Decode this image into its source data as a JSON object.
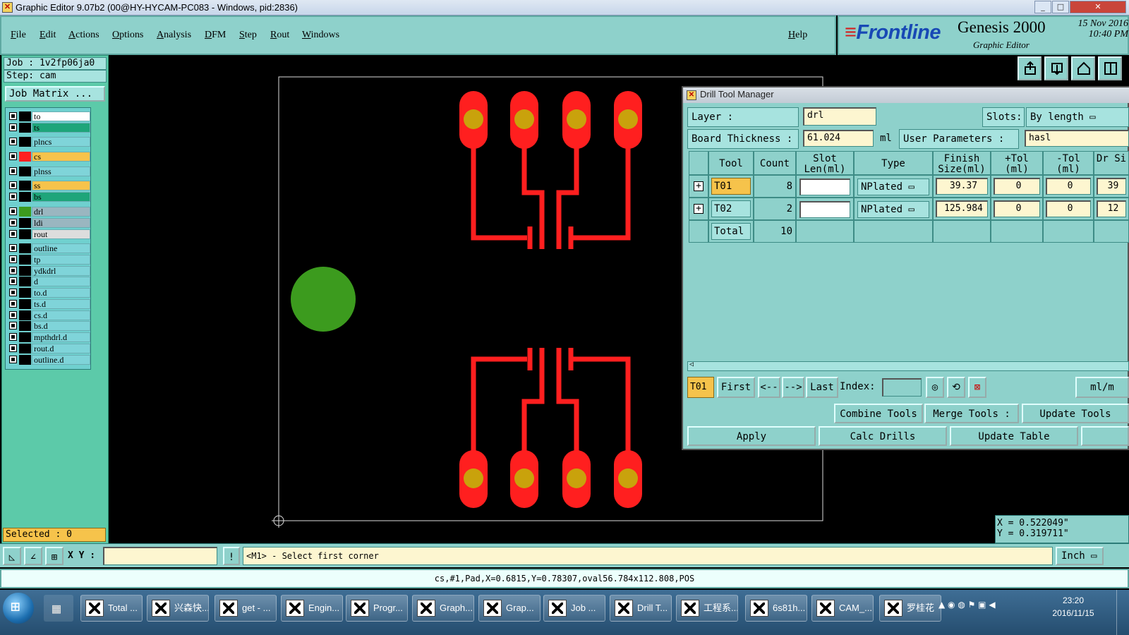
{
  "window": {
    "title": "Graphic Editor 9.07b2 (00@HY-HYCAM-PC083 - Windows, pid:2836)",
    "controls": [
      "_",
      "□",
      "✕"
    ]
  },
  "menu": {
    "items": [
      "File",
      "Edit",
      "Actions",
      "Options",
      "Analysis",
      "DFM",
      "Step",
      "Rout",
      "Windows"
    ],
    "help": "Help"
  },
  "branding": {
    "logo_text": "Frontline",
    "product": "Genesis 2000",
    "subtitle": "Graphic Editor",
    "date": "15 Nov 2016",
    "time": "10:40 PM"
  },
  "left_panel": {
    "job": "Job : 1v2fp06ja0",
    "step": "Step: cam",
    "job_matrix": "Job Matrix ...",
    "layers": [
      {
        "name": "to",
        "color": "#ffffff",
        "swatch": "#000000"
      },
      {
        "name": "ts",
        "color": "#1ea57a",
        "swatch": "#000000"
      },
      {
        "name": "plncs",
        "color": "#7fd4d9",
        "swatch": "#000000"
      },
      {
        "name": "cs",
        "color": "#f6c34b",
        "swatch": "#ff2020"
      },
      {
        "name": "plnss",
        "color": "#7fd4d9",
        "swatch": "#000000"
      },
      {
        "name": "ss",
        "color": "#f6c34b",
        "swatch": "#000000"
      },
      {
        "name": "bs",
        "color": "#1ea57a",
        "swatch": "#000000"
      },
      {
        "name": "drl",
        "color": "#9ab6c0",
        "swatch": "#3c9b1e"
      },
      {
        "name": "ldi",
        "color": "#9ab6c0",
        "swatch": "#000000"
      },
      {
        "name": "rout",
        "color": "#dddddd",
        "swatch": "#000000"
      },
      {
        "name": "outline",
        "color": "#7fd4d9",
        "swatch": "#000000"
      },
      {
        "name": "tp",
        "color": "#7fd4d9",
        "swatch": "#000000"
      },
      {
        "name": "ydkdrl",
        "color": "#7fd4d9",
        "swatch": "#000000"
      },
      {
        "name": "d",
        "color": "#7fd4d9",
        "swatch": "#000000"
      },
      {
        "name": "to.d",
        "color": "#7fd4d9",
        "swatch": "#000000"
      },
      {
        "name": "ts.d",
        "color": "#7fd4d9",
        "swatch": "#000000"
      },
      {
        "name": "cs.d",
        "color": "#7fd4d9",
        "swatch": "#000000"
      },
      {
        "name": "bs.d",
        "color": "#7fd4d9",
        "swatch": "#000000"
      },
      {
        "name": "mpthdrl.d",
        "color": "#7fd4d9",
        "swatch": "#000000"
      },
      {
        "name": "rout.d",
        "color": "#7fd4d9",
        "swatch": "#000000"
      },
      {
        "name": "outline.d",
        "color": "#7fd4d9",
        "swatch": "#000000"
      }
    ],
    "selected": "Selected : 0"
  },
  "drill_dialog": {
    "title": "Drill Tool Manager",
    "layer_label": "Layer           :",
    "layer_value": "drl",
    "slots_label": "Slots:",
    "slots_value": "By length",
    "board_thickness_label": "Board Thickness :",
    "board_thickness_value": "61.024",
    "board_thickness_unit": "ml",
    "user_params_label": "User Parameters :",
    "user_params_value": "hasl",
    "columns": [
      "Tool",
      "Count",
      "Slot Len(ml)",
      "Type",
      "Finish Size(ml)",
      "+Tol (ml)",
      "-Tol (ml)",
      "Dr Si"
    ],
    "rows": [
      {
        "tool": "T01",
        "count": "8",
        "slot_len": "",
        "type": "NPlated",
        "finish": "39.37",
        "plus_tol": "0",
        "minus_tol": "0",
        "drill": "39"
      },
      {
        "tool": "T02",
        "count": "2",
        "slot_len": "",
        "type": "NPlated",
        "finish": "125.984",
        "plus_tol": "0",
        "minus_tol": "0",
        "drill": "12"
      }
    ],
    "total_label": "Total",
    "total_count": "10",
    "nav": {
      "current": "T01",
      "first": "First",
      "prev": "<--",
      "next": "-->",
      "last": "Last",
      "index_label": "Index:",
      "units": "ml/m"
    },
    "buttons": {
      "combine": "Combine Tools",
      "merge": "Merge Tools :",
      "update_tools": "Update Tools",
      "apply": "Apply",
      "calc": "Calc Drills",
      "update_table": "Update Table"
    }
  },
  "coords": {
    "x": "X =  0.522049\"",
    "y": "Y =  0.319711\""
  },
  "command_bar": {
    "xy_label": "X Y :",
    "prompt": "<M1> - Select first corner",
    "units": "Inch"
  },
  "status_line": "cs,#1,Pad,X=0.6815,Y=0.78307,oval56.784x112.808,POS",
  "taskbar": {
    "tasks": [
      "Total ...",
      "兴森快...",
      "get - ...",
      "Engin...",
      "Progr...",
      "Graph...",
      "Grap...",
      "Job ...",
      "Drill T...",
      "工程系...",
      "6s81h...",
      "CAM_...",
      "罗桂花"
    ],
    "clock_time": "23:20",
    "clock_date": "2016/11/15"
  }
}
